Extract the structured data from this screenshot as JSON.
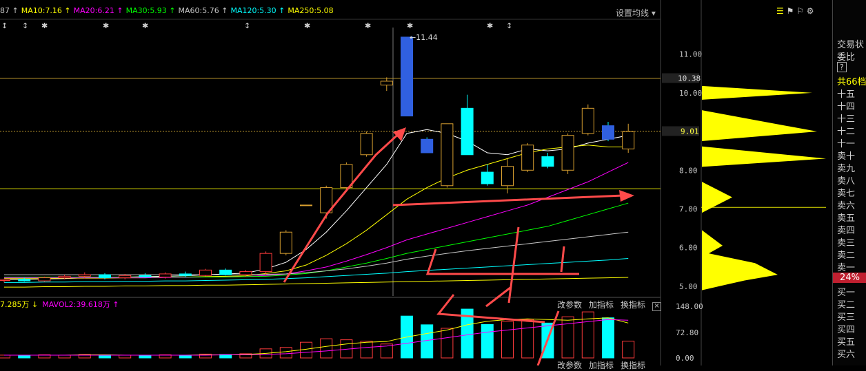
{
  "ma_line": [
    {
      "label": "87",
      "arrow": "↑",
      "color": "#c8c8c8"
    },
    {
      "label": "MA10:7.16",
      "arrow": "↑",
      "color": "#ffff00"
    },
    {
      "label": "MA20:6.21",
      "arrow": "↑",
      "color": "#ff00ff"
    },
    {
      "label": "MA30:5.93",
      "arrow": "↑",
      "color": "#00ff00"
    },
    {
      "label": "MA60:5.76",
      "arrow": "↑",
      "color": "#c8c8c8"
    },
    {
      "label": "MA120:5.30",
      "arrow": "↑",
      "color": "#00ffff"
    },
    {
      "label": "MA250:5.08",
      "arrow": "",
      "color": "#ffff00"
    }
  ],
  "settings_label": "设置均线",
  "vol_line": [
    {
      "label": "7.285万",
      "arrow": "↓",
      "color": "#ffff00"
    },
    {
      "label": "MAVOL2:39.618万",
      "arrow": "↑",
      "color": "#ff00ff"
    }
  ],
  "vol_buttons": [
    "改参数",
    "加指标",
    "换指标"
  ],
  "vol_close": "×",
  "bottom_buttons": [
    "改参数",
    "加指标",
    "换指标"
  ],
  "right_panel": {
    "items": [
      "交易状",
      "委比",
      "?",
      "共66档",
      "十五",
      "十四",
      "十三",
      "十二",
      "十一",
      "卖十",
      "卖九",
      "卖八",
      "卖七",
      "卖六",
      "卖五",
      "卖四",
      "卖三",
      "卖二",
      "卖一",
      "24%",
      "买一",
      "买二",
      "买三",
      "买四",
      "买五",
      "买六"
    ]
  },
  "colors": {
    "up": "#ff3b3b",
    "down": "#00ffff",
    "down_fill": "#3060e0",
    "ma5": "#ffffff",
    "ma10": "#ffff00",
    "ma20": "#ff00ff",
    "ma30": "#00ff00",
    "ma60": "#c8c8c8",
    "ma120": "#00ffff",
    "ma250": "#ffff00",
    "annotation": "#ff4a4a",
    "volume_profile": "#ffff00"
  },
  "chart_data": {
    "type": "candlestick",
    "price_axis": {
      "ticks": [
        5.0,
        6.0,
        7.0,
        8.0,
        9.0,
        10.0,
        11.0
      ],
      "ymin": 4.75,
      "ymax": 11.9
    },
    "current_price_label": "9.01",
    "high_marker_label": "10.38",
    "max_label": "11.44",
    "volume_axis": {
      "ticks": [
        "148.00",
        "72.80",
        "0.00"
      ],
      "max": 148
    },
    "candles": [
      {
        "o": 5.15,
        "h": 5.2,
        "l": 5.1,
        "c": 5.18,
        "v": 8
      },
      {
        "o": 5.18,
        "h": 5.22,
        "l": 5.12,
        "c": 5.14,
        "v": 7
      },
      {
        "o": 5.14,
        "h": 5.25,
        "l": 5.12,
        "c": 5.22,
        "v": 9
      },
      {
        "o": 5.22,
        "h": 5.3,
        "l": 5.18,
        "c": 5.26,
        "v": 8
      },
      {
        "o": 5.26,
        "h": 5.36,
        "l": 5.2,
        "c": 5.3,
        "v": 10
      },
      {
        "o": 5.3,
        "h": 5.34,
        "l": 5.18,
        "c": 5.22,
        "v": 9
      },
      {
        "o": 5.22,
        "h": 5.32,
        "l": 5.18,
        "c": 5.28,
        "v": 8
      },
      {
        "o": 5.28,
        "h": 5.34,
        "l": 5.22,
        "c": 5.24,
        "v": 7
      },
      {
        "o": 5.24,
        "h": 5.36,
        "l": 5.2,
        "c": 5.32,
        "v": 9
      },
      {
        "o": 5.32,
        "h": 5.38,
        "l": 5.24,
        "c": 5.28,
        "v": 8
      },
      {
        "o": 5.28,
        "h": 5.45,
        "l": 5.26,
        "c": 5.42,
        "v": 11
      },
      {
        "o": 5.42,
        "h": 5.46,
        "l": 5.28,
        "c": 5.3,
        "v": 10
      },
      {
        "o": 5.3,
        "h": 5.42,
        "l": 5.25,
        "c": 5.38,
        "v": 12
      },
      {
        "o": 5.38,
        "h": 5.9,
        "l": 5.3,
        "c": 5.85,
        "v": 26
      },
      {
        "o": 5.85,
        "h": 6.45,
        "l": 5.8,
        "c": 6.4,
        "v": 30
      },
      {
        "o": 7.1,
        "h": 7.1,
        "l": 7.1,
        "c": 7.1,
        "v": 45
      },
      {
        "o": 6.9,
        "h": 7.6,
        "l": 6.75,
        "c": 7.55,
        "v": 55
      },
      {
        "o": 7.55,
        "h": 8.2,
        "l": 7.5,
        "c": 8.15,
        "v": 52
      },
      {
        "o": 8.4,
        "h": 9.0,
        "l": 8.35,
        "c": 8.95,
        "v": 48
      },
      {
        "o": 10.2,
        "h": 10.4,
        "l": 10.05,
        "c": 10.3,
        "v": 40
      },
      {
        "o": 11.44,
        "h": 11.44,
        "l": 9.4,
        "c": 9.4,
        "v": 120
      },
      {
        "o": 8.8,
        "h": 8.85,
        "l": 8.45,
        "c": 8.45,
        "v": 95
      },
      {
        "o": 7.6,
        "h": 9.2,
        "l": 7.55,
        "c": 9.2,
        "v": 85
      },
      {
        "o": 9.6,
        "h": 9.95,
        "l": 8.4,
        "c": 8.4,
        "v": 140
      },
      {
        "o": 7.95,
        "h": 8.15,
        "l": 7.6,
        "c": 7.65,
        "v": 96
      },
      {
        "o": 7.6,
        "h": 8.3,
        "l": 7.4,
        "c": 8.1,
        "v": 105
      },
      {
        "o": 8.0,
        "h": 8.7,
        "l": 7.95,
        "c": 8.65,
        "v": 110
      },
      {
        "o": 8.35,
        "h": 8.45,
        "l": 8.05,
        "c": 8.1,
        "v": 100
      },
      {
        "o": 8.0,
        "h": 8.95,
        "l": 7.9,
        "c": 8.9,
        "v": 118
      },
      {
        "o": 8.95,
        "h": 9.7,
        "l": 8.9,
        "c": 9.6,
        "v": 132
      },
      {
        "o": 9.15,
        "h": 9.25,
        "l": 8.75,
        "c": 8.8,
        "v": 115
      },
      {
        "o": 8.55,
        "h": 9.2,
        "l": 8.45,
        "c": 9.0,
        "v": 48
      }
    ],
    "ma_series": [
      {
        "name": "MA5",
        "values": [
          5.18,
          5.18,
          5.19,
          5.2,
          5.22,
          5.23,
          5.24,
          5.25,
          5.26,
          5.27,
          5.3,
          5.32,
          5.34,
          5.45,
          5.62,
          5.95,
          6.4,
          6.95,
          7.55,
          8.15,
          8.95,
          9.05,
          8.95,
          8.75,
          8.45,
          8.4,
          8.55,
          8.5,
          8.55,
          8.7,
          8.8,
          8.9
        ]
      },
      {
        "name": "MA10",
        "values": [
          5.2,
          5.2,
          5.2,
          5.21,
          5.21,
          5.21,
          5.22,
          5.22,
          5.23,
          5.24,
          5.25,
          5.26,
          5.27,
          5.33,
          5.4,
          5.55,
          5.8,
          6.1,
          6.45,
          6.85,
          7.25,
          7.55,
          7.8,
          8.0,
          8.15,
          8.3,
          8.45,
          8.55,
          8.6,
          8.65,
          8.6,
          8.6
        ]
      },
      {
        "name": "MA20",
        "values": [
          5.22,
          5.22,
          5.22,
          5.22,
          5.22,
          5.22,
          5.22,
          5.22,
          5.23,
          5.23,
          5.24,
          5.24,
          5.25,
          5.28,
          5.32,
          5.4,
          5.5,
          5.65,
          5.82,
          6.0,
          6.2,
          6.35,
          6.5,
          6.65,
          6.8,
          6.95,
          7.1,
          7.3,
          7.5,
          7.7,
          7.95,
          8.2
        ]
      },
      {
        "name": "MA30",
        "values": [
          5.24,
          5.24,
          5.24,
          5.24,
          5.24,
          5.24,
          5.24,
          5.24,
          5.24,
          5.24,
          5.24,
          5.24,
          5.25,
          5.26,
          5.29,
          5.33,
          5.4,
          5.5,
          5.6,
          5.72,
          5.85,
          5.95,
          6.05,
          6.15,
          6.25,
          6.35,
          6.45,
          6.55,
          6.7,
          6.85,
          7.0,
          7.15
        ]
      },
      {
        "name": "MA60",
        "values": [
          5.3,
          5.3,
          5.3,
          5.3,
          5.3,
          5.3,
          5.3,
          5.3,
          5.3,
          5.3,
          5.3,
          5.3,
          5.3,
          5.31,
          5.32,
          5.35,
          5.4,
          5.45,
          5.52,
          5.6,
          5.7,
          5.78,
          5.85,
          5.92,
          5.98,
          6.04,
          6.1,
          6.16,
          6.22,
          6.28,
          6.34,
          6.4
        ]
      },
      {
        "name": "MA120",
        "values": [
          5.1,
          5.1,
          5.11,
          5.11,
          5.12,
          5.12,
          5.13,
          5.13,
          5.14,
          5.14,
          5.15,
          5.16,
          5.17,
          5.18,
          5.2,
          5.22,
          5.25,
          5.28,
          5.31,
          5.34,
          5.38,
          5.41,
          5.44,
          5.47,
          5.5,
          5.53,
          5.56,
          5.59,
          5.62,
          5.65,
          5.68,
          5.72
        ]
      },
      {
        "name": "MA250",
        "values": [
          4.98,
          4.98,
          4.99,
          4.99,
          5.0,
          5.0,
          5.01,
          5.01,
          5.02,
          5.02,
          5.03,
          5.03,
          5.04,
          5.05,
          5.06,
          5.07,
          5.08,
          5.09,
          5.1,
          5.11,
          5.12,
          5.13,
          5.14,
          5.15,
          5.16,
          5.17,
          5.18,
          5.19,
          5.2,
          5.21,
          5.22,
          5.23
        ]
      }
    ],
    "volume_ma": [
      {
        "name": "MAVOL1",
        "values": [
          8,
          8,
          8,
          8,
          9,
          9,
          8,
          8,
          8,
          8,
          9,
          9,
          10,
          13,
          18,
          25,
          33,
          40,
          45,
          47,
          60,
          70,
          80,
          95,
          105,
          110,
          112,
          110,
          108,
          112,
          115,
          100
        ]
      },
      {
        "name": "MAVOL2",
        "values": [
          8,
          8,
          8,
          8,
          8,
          8,
          8,
          8,
          8,
          8,
          8,
          9,
          9,
          10,
          12,
          16,
          20,
          25,
          30,
          34,
          42,
          50,
          58,
          66,
          74,
          80,
          86,
          92,
          98,
          104,
          110,
          108
        ]
      }
    ],
    "reference_lines": [
      10.38,
      9.01,
      7.52
    ]
  }
}
